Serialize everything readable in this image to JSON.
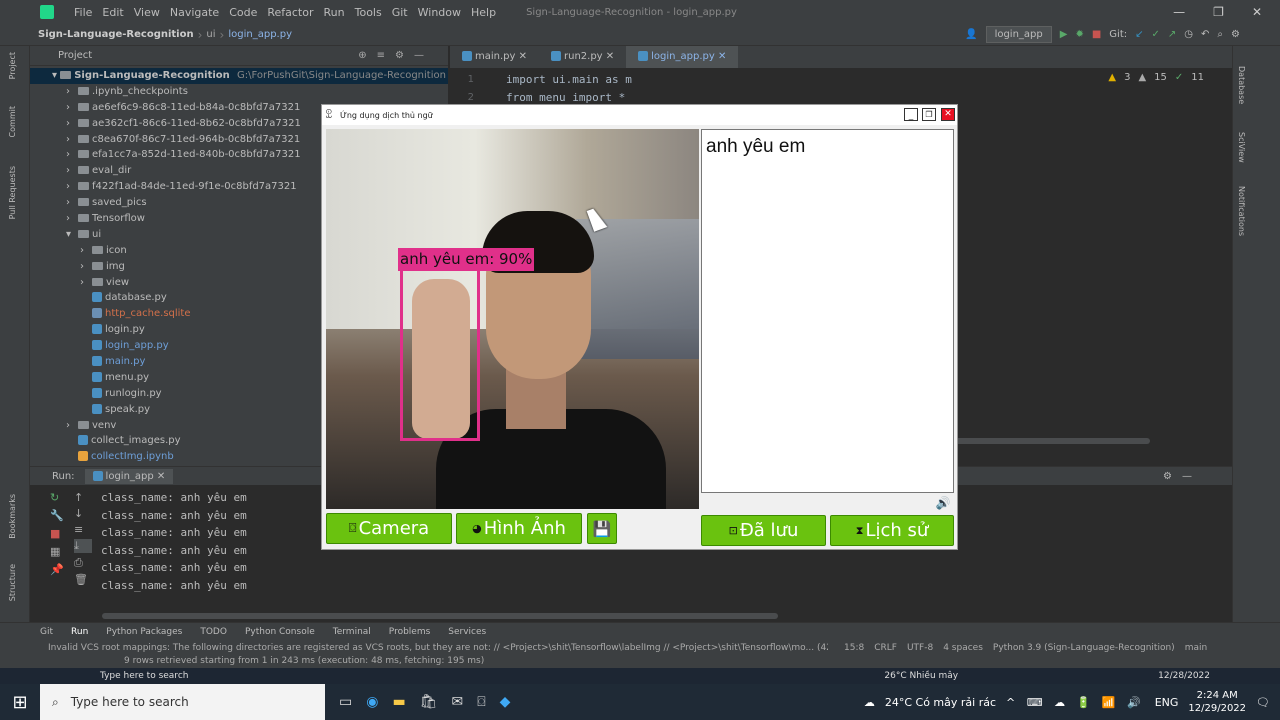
{
  "ide": {
    "window_title": "Sign-Language-Recognition - login_app.py",
    "menu": [
      "File",
      "Edit",
      "View",
      "Navigate",
      "Code",
      "Refactor",
      "Run",
      "Tools",
      "Git",
      "Window",
      "Help"
    ],
    "breadcrumb": [
      "Sign-Language-Recognition",
      "ui",
      "login_app.py"
    ],
    "run_config": "login_app",
    "git_label": "Git:",
    "editor_tabs": [
      "main.py",
      "run2.py",
      "login_app.py"
    ],
    "inspections": {
      "warnings": "3",
      "weak": "15",
      "typos": "11"
    },
    "code_lines": [
      {
        "num": "1",
        "text": "import ui.main as m"
      },
      {
        "num": "2",
        "text": "from menu import *"
      }
    ],
    "project_label": "Project",
    "project_root": "Sign-Language-Recognition",
    "project_path": "G:\\ForPushGit\\Sign-Language-Recognition",
    "tree": [
      {
        "label": ".ipynb_checkpoints",
        "type": "folder",
        "indent": 1
      },
      {
        "label": "ae6ef6c9-86c8-11ed-b84a-0c8bfd7a7321",
        "type": "folder",
        "indent": 1
      },
      {
        "label": "ae362cf1-86c6-11ed-8b62-0c8bfd7a7321",
        "type": "folder",
        "indent": 1
      },
      {
        "label": "c8ea670f-86c7-11ed-964b-0c8bfd7a7321",
        "type": "folder",
        "indent": 1
      },
      {
        "label": "efa1cc7a-852d-11ed-840b-0c8bfd7a7321",
        "type": "folder",
        "indent": 1
      },
      {
        "label": "eval_dir",
        "type": "folder",
        "indent": 1
      },
      {
        "label": "f422f1ad-84de-11ed-9f1e-0c8bfd7a7321",
        "type": "folder",
        "indent": 1
      },
      {
        "label": "saved_pics",
        "type": "folder",
        "indent": 1
      },
      {
        "label": "Tensorflow",
        "type": "folder",
        "indent": 1
      },
      {
        "label": "ui",
        "type": "folder",
        "indent": 1
      },
      {
        "label": "icon",
        "type": "folder",
        "indent": 2
      },
      {
        "label": "img",
        "type": "folder",
        "indent": 2
      },
      {
        "label": "view",
        "type": "folder",
        "indent": 2
      },
      {
        "label": "database.py",
        "type": "py",
        "indent": 2
      },
      {
        "label": "http_cache.sqlite",
        "type": "db",
        "indent": 2
      },
      {
        "label": "login.py",
        "type": "py",
        "indent": 2
      },
      {
        "label": "login_app.py",
        "type": "py-mod",
        "indent": 2
      },
      {
        "label": "main.py",
        "type": "py-mod",
        "indent": 2
      },
      {
        "label": "menu.py",
        "type": "py",
        "indent": 2
      },
      {
        "label": "runlogin.py",
        "type": "py",
        "indent": 2
      },
      {
        "label": "speak.py",
        "type": "py",
        "indent": 2
      },
      {
        "label": "venv",
        "type": "folder",
        "indent": 1
      },
      {
        "label": "collect_images.py",
        "type": "py",
        "indent": 1
      },
      {
        "label": "collectImg.ipynb",
        "type": "nb",
        "indent": 1
      }
    ],
    "run_label": "Run:",
    "run_tab": "login_app",
    "console_lines": [
      "class_name:  anh yêu em",
      "class_name:  anh yêu em",
      "class_name:  anh yêu em",
      "class_name:  anh yêu em",
      "class_name:  anh yêu em",
      "class_name:  anh yêu em"
    ],
    "tool_windows": [
      "Git",
      "Run",
      "Python Packages",
      "TODO",
      "Python Console",
      "Terminal",
      "Problems",
      "Services"
    ],
    "status_message": "Invalid VCS root mappings: The following directories are registered as VCS roots, but they are not: // <Project>\\shit\\Tensorflow\\labelImg // <Project>\\shit\\Tensorflow\\mo... (42 minutes",
    "status_right": [
      "15:8",
      "CRLF",
      "UTF-8",
      "4 spaces",
      "Python 3.9 (Sign-Language-Recognition)",
      "main"
    ],
    "rows_message": "9 rows retrieved starting from 1 in 243 ms (execution: 48 ms, fetching: 195 ms)",
    "left_strip": [
      "Project",
      "Commit",
      "Pull Requests",
      "Bookmarks",
      "Structure"
    ],
    "right_strip": [
      "Database",
      "SciView",
      "Notifications"
    ]
  },
  "app": {
    "title": "Ứng dụng dịch thủ ngữ",
    "detection_label": "anh yêu em: 90%",
    "result_text": "anh yêu em",
    "buttons": {
      "camera": "Camera",
      "image": "Hình Ảnh",
      "saved": "Đã lưu",
      "history": "Lịch sử"
    }
  },
  "taskbar": {
    "search_placeholder": "Type here to search",
    "weather": "24°C  Có mây rải rác",
    "weather_upper": "26°C  Nhiều mây",
    "lang": "ENG",
    "time": "2:24 AM",
    "date": "12/29/2022",
    "date_upper": "12/28/2022"
  }
}
